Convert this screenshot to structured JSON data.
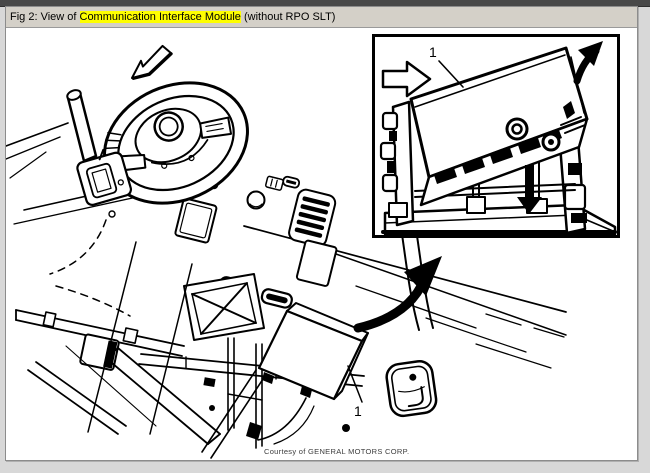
{
  "title_bar": {
    "prefix": "Fig 2: View of ",
    "highlight": "Communication Interface Module",
    "suffix": " (without RPO SLT)"
  },
  "figure": {
    "callout_main": "1",
    "callout_inset": "1",
    "courtesy": "Courtesy of GENERAL MOTORS CORP."
  },
  "icons": {
    "top_left_arrow": "direction-arrow-outline-left",
    "main_curved_arrow": "rotate-up-arrow",
    "inset_block_arrow": "insert-direction-arrow-right",
    "inset_curved_arrow": "rotate-up-arrow",
    "inset_down_arrow": "press-down-arrow"
  },
  "colors": {
    "highlight": "#ffff00",
    "title_bar_bg": "#d4d0c8",
    "page_bg": "#d8d8d8",
    "top_bar": "#484848",
    "line_art": "#000000",
    "canvas": "#ffffff"
  }
}
